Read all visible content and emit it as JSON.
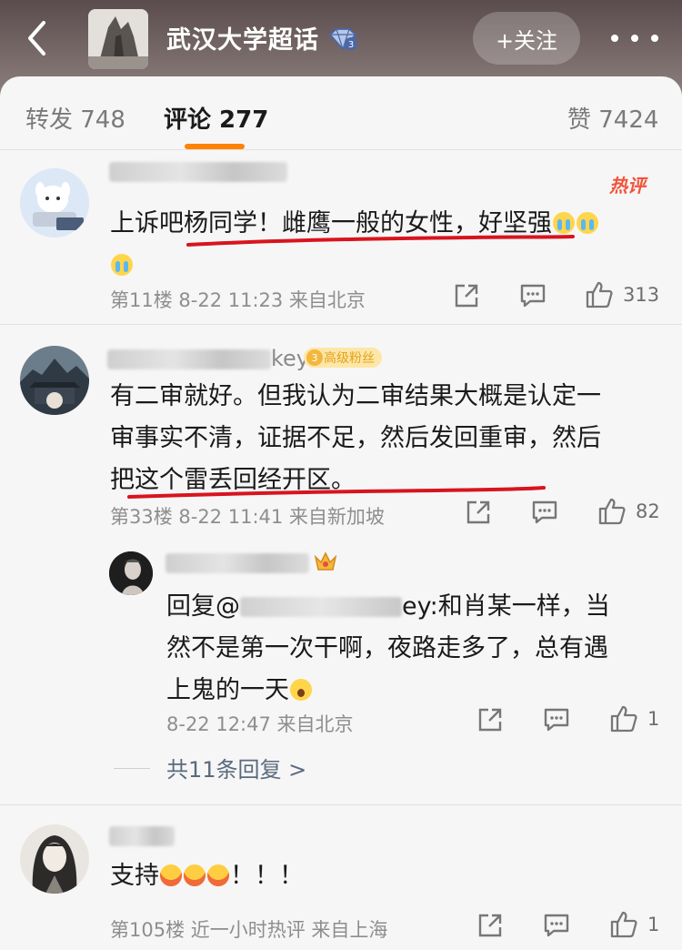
{
  "header": {
    "title": "武汉大学超话",
    "follow_label": "+关注"
  },
  "tabs": [
    {
      "label": "转发 748"
    },
    {
      "label": "评论 277"
    },
    {
      "label": "赞 7424"
    }
  ],
  "comments": [
    {
      "username_tail": "",
      "hot_tag": "热评",
      "text_line1": "上诉吧杨同学！雌鹰一般的女性，好坚强",
      "meta": "第11楼  8-22 11:23  来自北京",
      "likes": "313"
    },
    {
      "username_tail": "key",
      "fan_badge_level": "3",
      "fan_badge": "高级粉丝",
      "text_line1": "有二审就好。但我认为二审结果大概是认定一",
      "text_line2": "审事实不清，证据不足，然后发回重审，然后",
      "text_line3": "把这个雷丢回经开区。",
      "meta": "第33楼  8-22 11:41  来自新加坡",
      "likes": "82",
      "reply": {
        "prefix": "回复@",
        "mention_blur_tail": "ey",
        "line1_rest": ":和肖某一样，当",
        "line2": "然不是第一次干啊，夜路走多了，总有遇",
        "line3": "上鬼的一天",
        "meta": "8-22 12:47  来自北京",
        "likes": "1"
      },
      "replies_link": "共11条回复 >"
    },
    {
      "username_tail": "",
      "text_line1_start": "支持",
      "text_line1_end": "！！！",
      "meta": "第105楼  近一小时热评  来自上海",
      "likes": "1"
    }
  ],
  "colors": {
    "accent": "#ff8200",
    "hot": "#f2533a",
    "red_underline": "#d8141e",
    "link": "#5a6a7e"
  }
}
